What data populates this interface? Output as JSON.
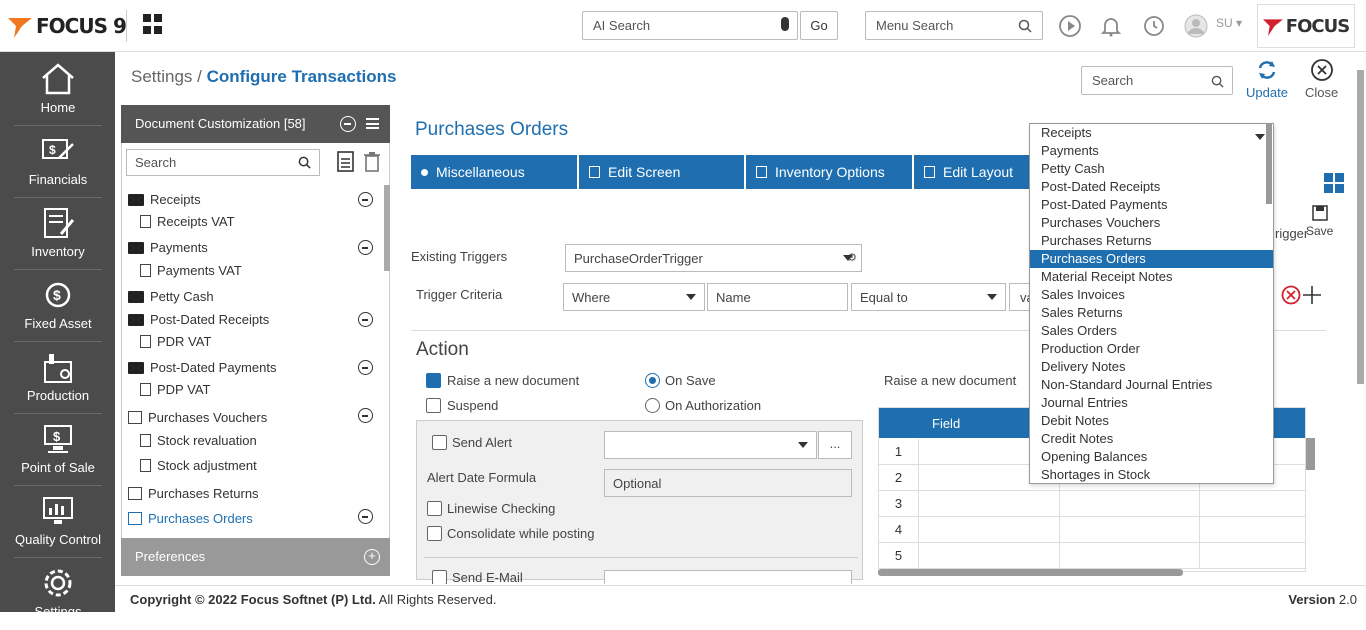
{
  "topbar": {
    "app_name": "FOCUS 9",
    "ai_search_placeholder": "AI Search",
    "go_label": "Go",
    "menu_search_placeholder": "Menu Search",
    "user": "SU",
    "brand": "FOCUS"
  },
  "sidebar": {
    "items": [
      {
        "label": "Home"
      },
      {
        "label": "Financials"
      },
      {
        "label": "Inventory"
      },
      {
        "label": "Fixed Asset"
      },
      {
        "label": "Production"
      },
      {
        "label": "Point of Sale"
      },
      {
        "label": "Quality Control"
      },
      {
        "label": "Settings"
      }
    ]
  },
  "breadcrumb": {
    "parent": "Settings",
    "separator": " / ",
    "current": "Configure Transactions"
  },
  "header": {
    "search_placeholder": "Search",
    "update_label": "Update",
    "close_label": "Close"
  },
  "left_panel": {
    "title": "Document Customization [58]",
    "search_placeholder": "Search",
    "preferences": "Preferences",
    "tree": [
      {
        "label": "Receipts",
        "type": "folder"
      },
      {
        "label": "Receipts VAT",
        "type": "doc"
      },
      {
        "label": "Payments",
        "type": "folder"
      },
      {
        "label": "Payments VAT",
        "type": "doc"
      },
      {
        "label": "Petty Cash",
        "type": "folder"
      },
      {
        "label": "Post-Dated Receipts",
        "type": "folder"
      },
      {
        "label": "PDR VAT",
        "type": "doc"
      },
      {
        "label": "Post-Dated Payments",
        "type": "folder"
      },
      {
        "label": "PDP VAT",
        "type": "doc"
      },
      {
        "label": "Purchases Vouchers",
        "type": "list"
      },
      {
        "label": "Stock revaluation",
        "type": "doc"
      },
      {
        "label": "Stock adjustment",
        "type": "doc"
      },
      {
        "label": "Purchases Returns",
        "type": "list"
      },
      {
        "label": "Purchases Orders",
        "type": "list",
        "active": true
      }
    ]
  },
  "main": {
    "title": "Purchases Orders",
    "tabs": [
      {
        "label": "Miscellaneous"
      },
      {
        "label": "Edit Screen"
      },
      {
        "label": "Inventory Options"
      },
      {
        "label": "Edit Layout"
      }
    ],
    "existing_triggers_label": "Existing Triggers",
    "existing_triggers_value": "PurchaseOrderTrigger",
    "trigger_criteria_label": "Trigger Criteria",
    "criteria_where": "Where",
    "criteria_field": "Name",
    "criteria_op": "Equal to",
    "criteria_value": "va",
    "trigger_label_partial": "rigger",
    "save_label": "Save",
    "action_heading": "Action",
    "raise_new_document": "Raise a new document",
    "suspend": "Suspend",
    "on_save": "On Save",
    "on_authorization": "On Authorization",
    "send_alert": "Send Alert",
    "alert_date_formula": "Alert Date Formula",
    "optional": "Optional",
    "linewise_checking": "Linewise Checking",
    "consolidate_while_posting": "Consolidate while posting",
    "send_email": "Send E-Mail",
    "raise_new_document_right": "Raise a new document",
    "table": {
      "header_field": "Field",
      "rows": [
        "1",
        "2",
        "3",
        "4",
        "5"
      ]
    }
  },
  "dropdown": {
    "items": [
      "Receipts",
      "Payments",
      "Petty Cash",
      "Post-Dated Receipts",
      "Post-Dated Payments",
      "Purchases Vouchers",
      "Purchases Returns",
      "Purchases Orders",
      "Material Receipt Notes",
      "Sales Invoices",
      "Sales Returns",
      "Sales Orders",
      "Production Order",
      "Delivery Notes",
      "Non-Standard Journal Entries",
      "Journal Entries",
      "Debit Notes",
      "Credit Notes",
      "Opening Balances",
      "Shortages in Stock"
    ],
    "selected": "Purchases Orders"
  },
  "footer": {
    "copyright_bold": "Copyright © 2022 Focus Softnet (P) Ltd.",
    "copyright_rest": " All Rights Reserved.",
    "version_label": "Version ",
    "version": "2.0"
  },
  "colors": {
    "accent": "#1f6fb0",
    "sidebar": "#4b4b4b",
    "danger": "#d0212c"
  }
}
